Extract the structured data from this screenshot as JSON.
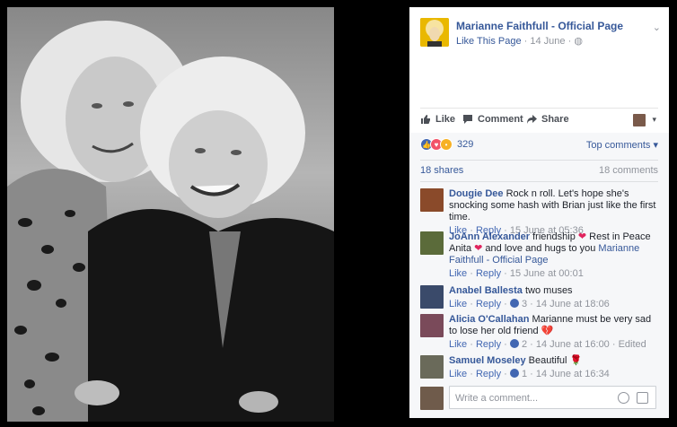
{
  "post": {
    "page_name": "Marianne Faithfull - Official Page",
    "like_page": "Like This Page",
    "date": "14 June",
    "dot": "·",
    "chevron": "⌄"
  },
  "actions": {
    "like": "Like",
    "comment": "Comment",
    "share": "Share",
    "caret": "▾"
  },
  "reactions": {
    "count": "329",
    "top_comments": "Top comments ▾",
    "shares": "18 shares",
    "comments_count": "18 comments",
    "icons": [
      "like-icon",
      "love-icon",
      "sad-icon"
    ],
    "colors": {
      "like": "#4267b2",
      "love": "#f25268",
      "sad": "#f7b125"
    }
  },
  "comments": [
    {
      "author": "Dougie Dee",
      "text": "Rock n roll. Let's hope she's snocking some hash with Brian just like the first time.",
      "like": "Like",
      "reply": "Reply",
      "time": "15 June at 05:36",
      "avatar_color": "#8a4a2a"
    },
    {
      "author": "JoAnn Alexander",
      "text1": "friendship",
      "text2": "Rest in Peace Anita",
      "text3": "and love and hugs to you",
      "mention": "Marianne Faithfull - Official Page",
      "like": "Like",
      "reply": "Reply",
      "time": "15 June at 00:01",
      "avatar_color": "#5b6b3a"
    },
    {
      "author": "Anabel Ballesta",
      "text": "two muses",
      "like": "Like",
      "reply": "Reply",
      "likes": "3",
      "time": "14 June at 18:06",
      "avatar_color": "#3a4a6a"
    },
    {
      "author": "Alicia O'Callahan",
      "text": "Marianne must be very sad to lose her old friend",
      "like": "Like",
      "reply": "Reply",
      "likes": "2",
      "time": "14 June at 16:00",
      "edited": "Edited",
      "avatar_color": "#7a4a5a"
    },
    {
      "author": "Samuel Moseley",
      "text": "Beautiful",
      "like": "Like",
      "reply": "Reply",
      "likes": "1",
      "time": "14 June at 16:34",
      "avatar_color": "#6a6a5a"
    }
  ],
  "write": {
    "placeholder": "Write a comment..."
  }
}
